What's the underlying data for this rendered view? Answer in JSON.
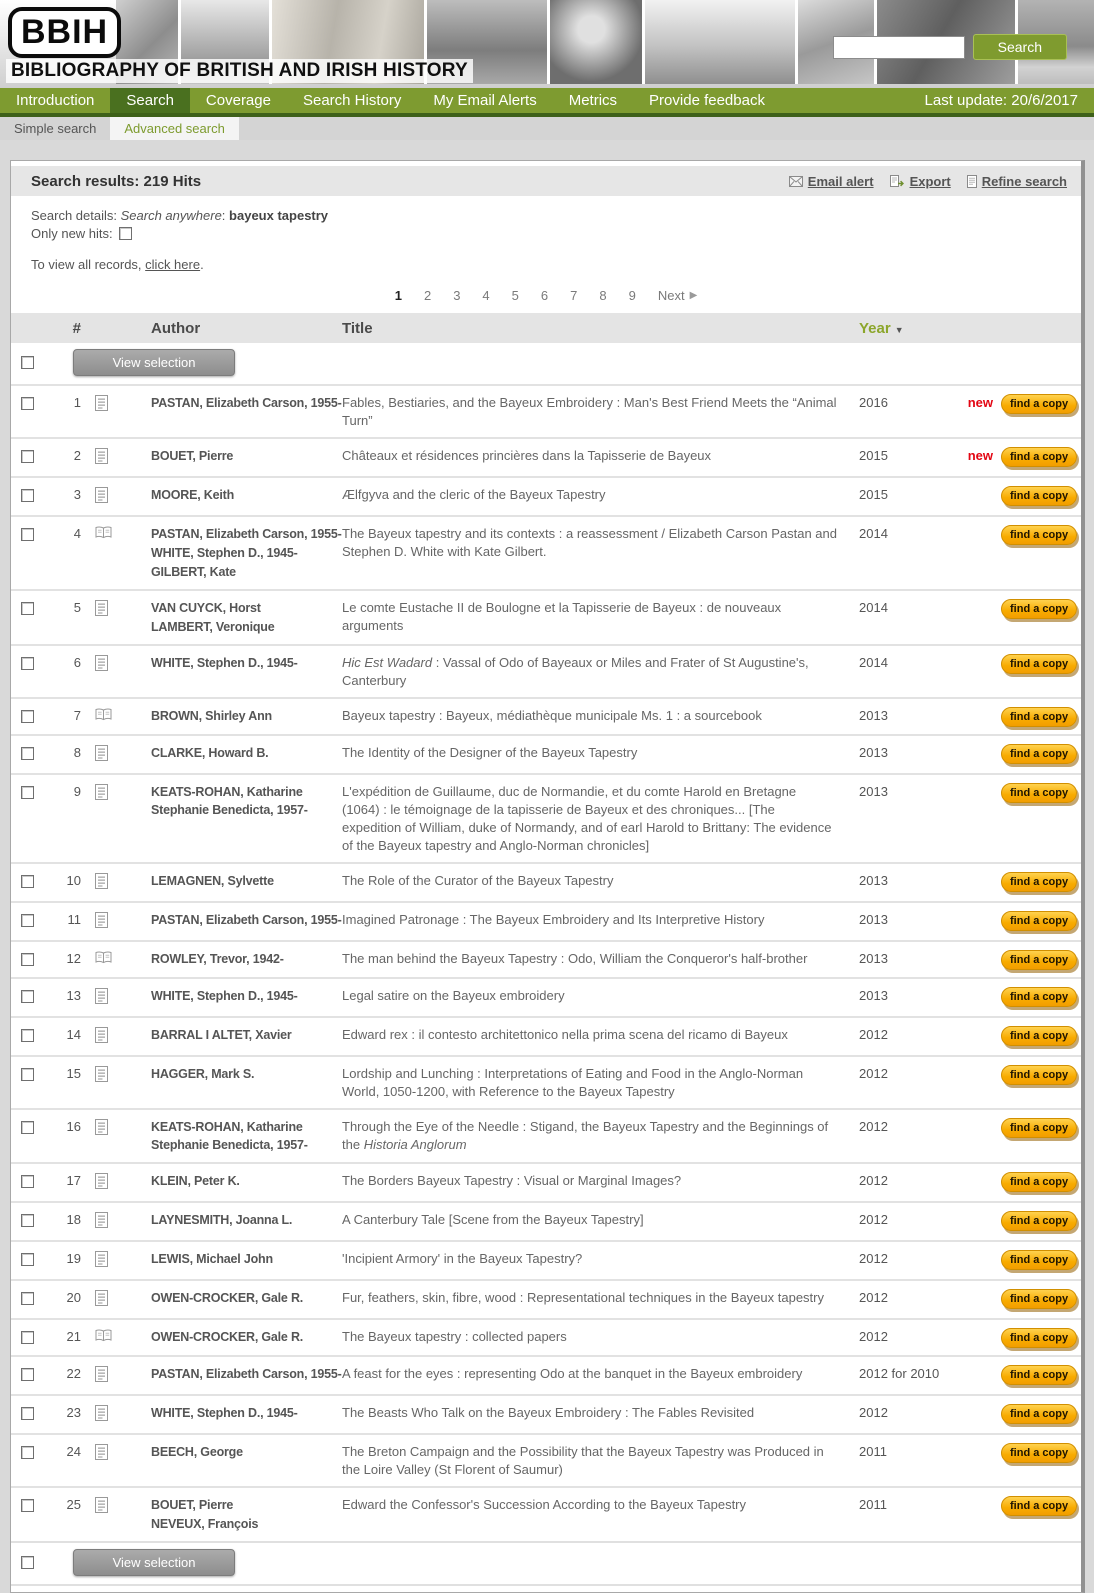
{
  "header": {
    "logo_text": "BBIH",
    "site_title": "BIBLIOGRAPHY OF BRITISH AND IRISH HISTORY",
    "search_value": "",
    "search_button_label": "Search"
  },
  "nav": {
    "items": [
      {
        "label": "Introduction",
        "active": false
      },
      {
        "label": "Search",
        "active": true
      },
      {
        "label": "Coverage",
        "active": false
      },
      {
        "label": "Search History",
        "active": false
      },
      {
        "label": "My Email Alerts",
        "active": false
      },
      {
        "label": "Metrics",
        "active": false
      },
      {
        "label": "Provide feedback",
        "active": false
      }
    ],
    "last_update": "Last update: 20/6/2017"
  },
  "subnav": {
    "tabs": [
      {
        "label": "Simple search",
        "active": false
      },
      {
        "label": "Advanced search",
        "active": true
      }
    ]
  },
  "results": {
    "title": "Search results: 219 Hits",
    "actions": [
      {
        "label": "Email alert",
        "icon": "envelope-icon"
      },
      {
        "label": "Export",
        "icon": "export-icon"
      },
      {
        "label": "Refine search",
        "icon": "page-icon"
      }
    ],
    "details": {
      "label": "Search details:",
      "field": "Search anywhere",
      "colon": ":",
      "query": "bayeux tapestry"
    },
    "only_new_label": "Only new hits:",
    "view_all": {
      "prefix": "To view all records,",
      "link": "click here",
      "suffix": "."
    },
    "pagination": {
      "pages": [
        "1",
        "2",
        "3",
        "4",
        "5",
        "6",
        "7",
        "8",
        "9"
      ],
      "current": "1",
      "next_label": "Next"
    },
    "table": {
      "col_num": "#",
      "col_author": "Author",
      "col_title": "Title",
      "col_year": "Year",
      "sort_icon": "▼"
    },
    "view_selection_label": "View selection",
    "new_label": "new",
    "find_copy_label": "find a copy",
    "rows": [
      {
        "num": "1",
        "icon": "article",
        "authors": [
          "PASTAN, Elizabeth Carson, 1955-"
        ],
        "title": [
          {
            "t": "Fables, Bestiaries, and the Bayeux Embroidery : Man's Best Friend Meets the “Animal Turn”"
          }
        ],
        "year": "2016",
        "is_new": true
      },
      {
        "num": "2",
        "icon": "article",
        "authors": [
          "BOUET, Pierre"
        ],
        "title": [
          {
            "t": "Châteaux et résidences princières dans la Tapisserie de Bayeux"
          }
        ],
        "year": "2015",
        "is_new": true
      },
      {
        "num": "3",
        "icon": "article",
        "authors": [
          "MOORE, Keith"
        ],
        "title": [
          {
            "t": "Ælfgyva and the cleric of the Bayeux Tapestry"
          }
        ],
        "year": "2015",
        "is_new": false
      },
      {
        "num": "4",
        "icon": "book",
        "authors": [
          "PASTAN, Elizabeth Carson, 1955-",
          "WHITE, Stephen D., 1945-",
          "GILBERT, Kate"
        ],
        "title": [
          {
            "t": "The Bayeux tapestry and its contexts : a reassessment / Elizabeth Carson Pastan and Stephen D. White with Kate Gilbert."
          }
        ],
        "year": "2014",
        "is_new": false
      },
      {
        "num": "5",
        "icon": "article",
        "authors": [
          "VAN CUYCK, Horst",
          "LAMBERT, Veronique"
        ],
        "title": [
          {
            "t": "Le comte Eustache II de Boulogne et la Tapisserie de Bayeux : de nouveaux arguments"
          }
        ],
        "year": "2014",
        "is_new": false
      },
      {
        "num": "6",
        "icon": "article",
        "authors": [
          "WHITE, Stephen D., 1945-"
        ],
        "title": [
          {
            "t": "Hic Est Wadard",
            "i": true
          },
          {
            "t": " : Vassal of Odo of Bayeaux or Miles and Frater of St Augustine's, Canterbury"
          }
        ],
        "year": "2014",
        "is_new": false
      },
      {
        "num": "7",
        "icon": "book",
        "authors": [
          "BROWN, Shirley Ann"
        ],
        "title": [
          {
            "t": "Bayeux tapestry : Bayeux, médiathèque municipale Ms. 1 : a sourcebook"
          }
        ],
        "year": "2013",
        "is_new": false
      },
      {
        "num": "8",
        "icon": "article",
        "authors": [
          "CLARKE, Howard B."
        ],
        "title": [
          {
            "t": "The Identity of the Designer of the Bayeux Tapestry"
          }
        ],
        "year": "2013",
        "is_new": false
      },
      {
        "num": "9",
        "icon": "article",
        "authors": [
          "KEATS-ROHAN, Katharine Stephanie Benedicta, 1957-"
        ],
        "title": [
          {
            "t": "L'expédition de Guillaume, duc de Normandie, et du comte Harold en Bretagne (1064) : le témoignage de la tapisserie de Bayeux et des chroniques... [The expedition of William, duke of Normandy, and of earl Harold to Brittany: The evidence of the Bayeux tapestry and Anglo-Norman chronicles]"
          }
        ],
        "year": "2013",
        "is_new": false
      },
      {
        "num": "10",
        "icon": "article",
        "authors": [
          "LEMAGNEN, Sylvette"
        ],
        "title": [
          {
            "t": "The Role of the Curator of the Bayeux Tapestry"
          }
        ],
        "year": "2013",
        "is_new": false
      },
      {
        "num": "11",
        "icon": "article",
        "authors": [
          "PASTAN, Elizabeth Carson, 1955-"
        ],
        "title": [
          {
            "t": "Imagined Patronage : The Bayeux Embroidery and Its Interpretive History"
          }
        ],
        "year": "2013",
        "is_new": false
      },
      {
        "num": "12",
        "icon": "book",
        "authors": [
          "ROWLEY, Trevor, 1942-"
        ],
        "title": [
          {
            "t": "The man behind the Bayeux Tapestry : Odo, William the Conqueror's half-brother"
          }
        ],
        "year": "2013",
        "is_new": false
      },
      {
        "num": "13",
        "icon": "article",
        "authors": [
          "WHITE, Stephen D., 1945-"
        ],
        "title": [
          {
            "t": "Legal satire on the Bayeux embroidery"
          }
        ],
        "year": "2013",
        "is_new": false
      },
      {
        "num": "14",
        "icon": "article",
        "authors": [
          "BARRAL I ALTET, Xavier"
        ],
        "title": [
          {
            "t": "Edward rex : il contesto architettonico nella prima scena del ricamo di Bayeux"
          }
        ],
        "year": "2012",
        "is_new": false
      },
      {
        "num": "15",
        "icon": "article",
        "authors": [
          "HAGGER, Mark S."
        ],
        "title": [
          {
            "t": "Lordship and Lunching : Interpretations of Eating and Food in the Anglo-Norman World, 1050-1200, with Reference to the Bayeux Tapestry"
          }
        ],
        "year": "2012",
        "is_new": false
      },
      {
        "num": "16",
        "icon": "article",
        "authors": [
          "KEATS-ROHAN, Katharine Stephanie Benedicta, 1957-"
        ],
        "title": [
          {
            "t": "Through the Eye of the Needle : Stigand, the Bayeux Tapestry and the Beginnings of the "
          },
          {
            "t": "Historia Anglorum",
            "i": true
          }
        ],
        "year": "2012",
        "is_new": false
      },
      {
        "num": "17",
        "icon": "article",
        "authors": [
          "KLEIN, Peter K."
        ],
        "title": [
          {
            "t": "The Borders Bayeux Tapestry : Visual or Marginal Images?"
          }
        ],
        "year": "2012",
        "is_new": false
      },
      {
        "num": "18",
        "icon": "article",
        "authors": [
          "LAYNESMITH, Joanna L."
        ],
        "title": [
          {
            "t": "A Canterbury Tale [Scene from the Bayeux Tapestry]"
          }
        ],
        "year": "2012",
        "is_new": false
      },
      {
        "num": "19",
        "icon": "article",
        "authors": [
          "LEWIS, Michael John"
        ],
        "title": [
          {
            "t": "'Incipient Armory' in the Bayeux Tapestry?"
          }
        ],
        "year": "2012",
        "is_new": false
      },
      {
        "num": "20",
        "icon": "article",
        "authors": [
          "OWEN-CROCKER, Gale R."
        ],
        "title": [
          {
            "t": "Fur, feathers, skin, fibre, wood : Representational techniques in the Bayeux tapestry"
          }
        ],
        "year": "2012",
        "is_new": false
      },
      {
        "num": "21",
        "icon": "book",
        "authors": [
          "OWEN-CROCKER, Gale R."
        ],
        "title": [
          {
            "t": "The Bayeux tapestry : collected papers"
          }
        ],
        "year": "2012",
        "is_new": false
      },
      {
        "num": "22",
        "icon": "article",
        "authors": [
          "PASTAN, Elizabeth Carson, 1955-"
        ],
        "title": [
          {
            "t": "A feast for the eyes : representing Odo at the banquet in the Bayeux embroidery"
          }
        ],
        "year": "2012 for 2010",
        "is_new": false
      },
      {
        "num": "23",
        "icon": "article",
        "authors": [
          "WHITE, Stephen D., 1945-"
        ],
        "title": [
          {
            "t": "The Beasts Who Talk on the Bayeux Embroidery : The Fables Revisited"
          }
        ],
        "year": "2012",
        "is_new": false
      },
      {
        "num": "24",
        "icon": "article",
        "authors": [
          "BEECH, George"
        ],
        "title": [
          {
            "t": "The Breton Campaign and the Possibility that the Bayeux Tapestry was Produced in the Loire Valley (St Florent of Saumur)"
          }
        ],
        "year": "2011",
        "is_new": false
      },
      {
        "num": "25",
        "icon": "article",
        "authors": [
          "BOUET, Pierre",
          "NEVEUX, François"
        ],
        "title": [
          {
            "t": "Edward the Confessor's Succession According to the Bayeux Tapestry"
          }
        ],
        "year": "2011",
        "is_new": false
      }
    ]
  },
  "colors": {
    "nav_green": "#7e9b30",
    "nav_active_green": "#4a701f",
    "year_header_green": "#8ca62b",
    "new_red": "#e30613",
    "find_copy_orange": "#f8ab00"
  }
}
